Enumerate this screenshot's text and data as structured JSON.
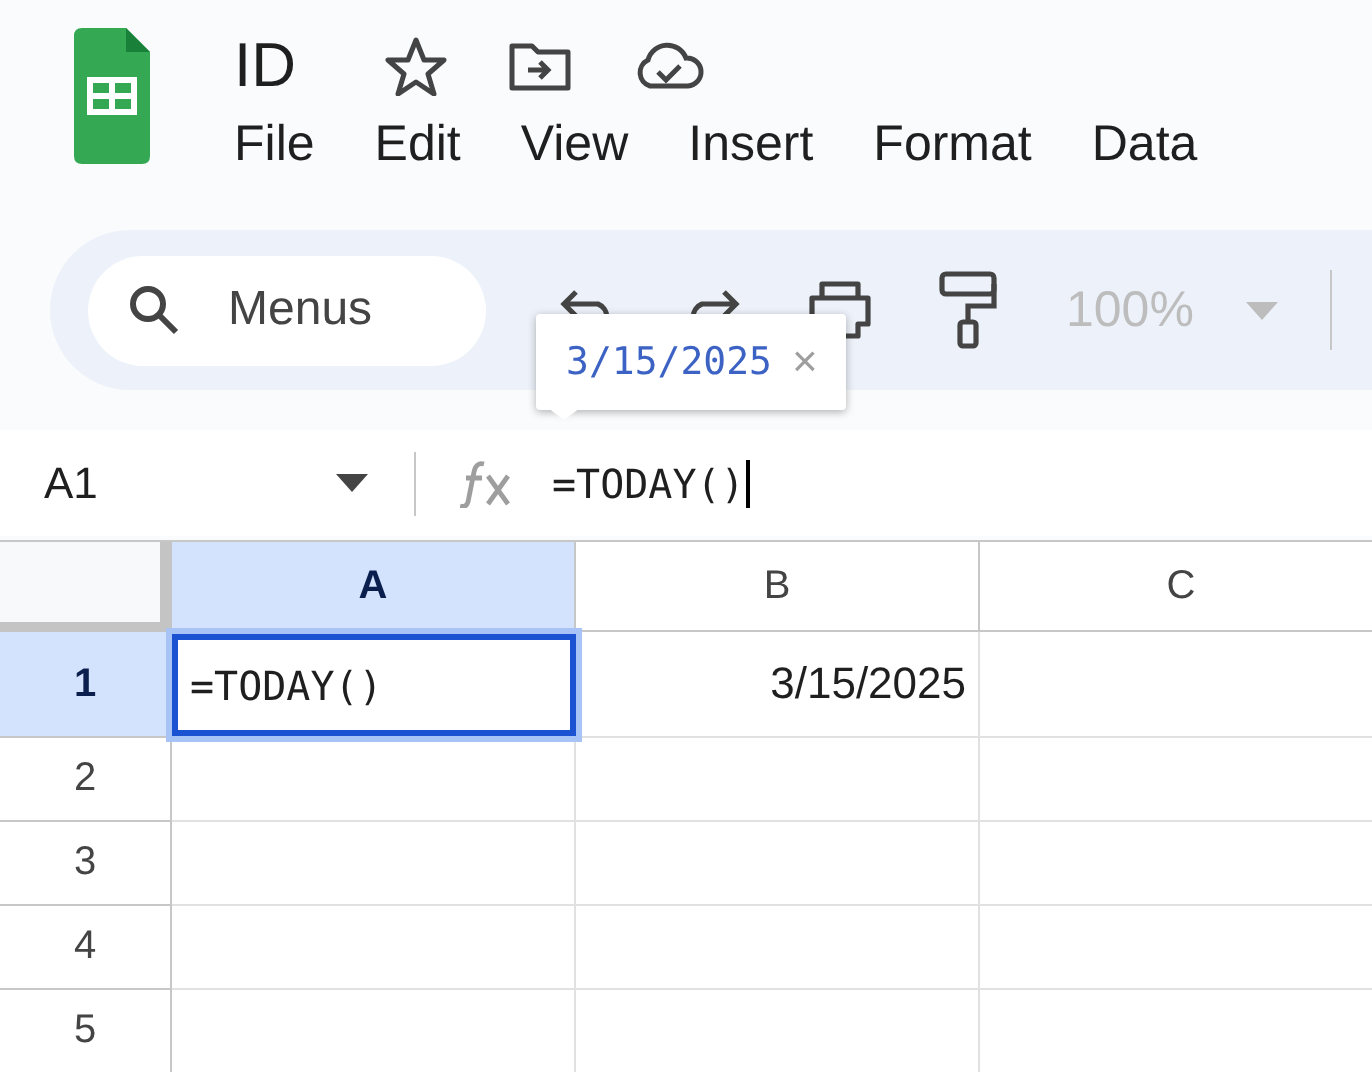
{
  "document": {
    "title": "ID"
  },
  "menu": [
    "File",
    "Edit",
    "View",
    "Insert",
    "Format",
    "Data"
  ],
  "toolbar": {
    "search": {
      "placeholder": "Menus"
    },
    "zoom": {
      "value": "100%",
      "disabled": true
    }
  },
  "tooltip": {
    "text": "3/15/2025",
    "close": "×"
  },
  "formula_bar": {
    "name_box": "A1",
    "formula": "=TODAY()"
  },
  "columns": [
    {
      "label": "A",
      "selected": true
    },
    {
      "label": "B",
      "selected": false
    },
    {
      "label": "C",
      "selected": false
    }
  ],
  "rows": [
    {
      "label": "1",
      "selected": true,
      "cells": [
        {
          "text": "=TODAY()",
          "kind": "formula",
          "selected": true
        },
        {
          "text": "3/15/2025",
          "kind": "value",
          "selected": false
        },
        {
          "text": "",
          "kind": "empty",
          "selected": false
        }
      ]
    },
    {
      "label": "2",
      "selected": false,
      "cells": []
    },
    {
      "label": "3",
      "selected": false,
      "cells": []
    },
    {
      "label": "4",
      "selected": false,
      "cells": []
    },
    {
      "label": "5",
      "selected": false,
      "cells": []
    }
  ]
}
